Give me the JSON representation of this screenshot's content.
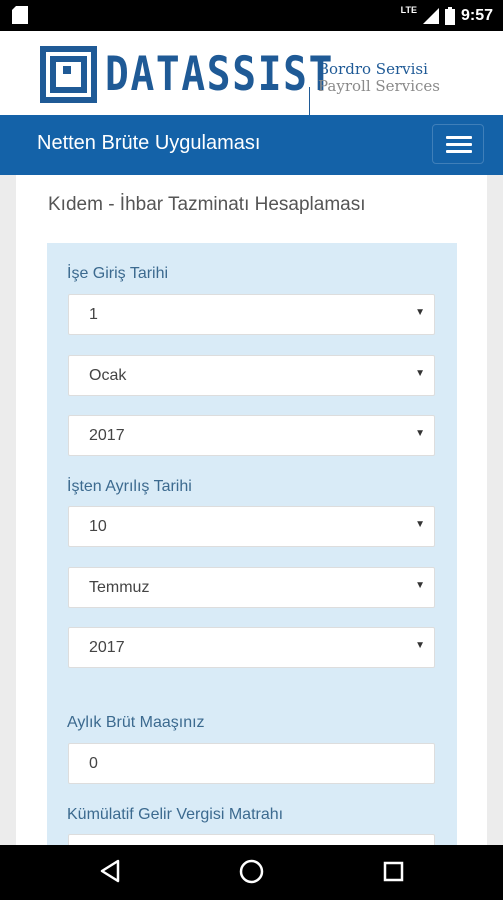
{
  "status_bar": {
    "network": "LTE",
    "time": "9:57"
  },
  "logo": {
    "word": "DATASSIST",
    "sub_line1": "Bordro Servisi",
    "sub_line2": "Payroll Services"
  },
  "navbar": {
    "title": "Netten Brüte Uygulaması",
    "menu_icon": "hamburger-icon"
  },
  "page": {
    "title": "Kıdem - İhbar Tazminatı Hesaplaması"
  },
  "form": {
    "start_label": "İşe Giriş Tarihi",
    "start_day": "1",
    "start_month": "Ocak",
    "start_year": "2017",
    "end_label": "İşten Ayrılış Tarihi",
    "end_day": "10",
    "end_month": "Temmuz",
    "end_year": "2017",
    "salary_label": "Aylık Brüt Maaşınız",
    "salary_value": "0",
    "tax_label": "Kümülatif Gelir Vergisi Matrahı"
  },
  "system_nav": {
    "back": "back-icon",
    "home": "home-icon",
    "recents": "recents-icon"
  }
}
